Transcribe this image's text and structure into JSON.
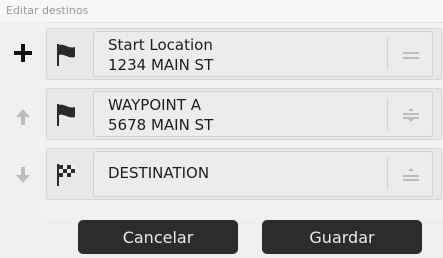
{
  "header": {
    "title": "Editar destinos"
  },
  "routes": [
    {
      "name": "Start Location",
      "address": "1234 MAIN ST",
      "flag_icon": "start-flag-icon",
      "handle_icon": "reorder-handle-icon"
    },
    {
      "name": "WAYPOINT A",
      "address": "5678 MAIN ST",
      "flag_icon": "waypoint-flag-icon",
      "handle_icon": "reorder-handle-icon"
    },
    {
      "name": "DESTINATION",
      "address": "",
      "flag_icon": "destination-checkered-flag-icon",
      "handle_icon": "reorder-handle-icon"
    }
  ],
  "sidebar": {
    "add_icon": "plus-icon",
    "up_icon": "arrow-up-icon",
    "down_icon": "arrow-down-icon",
    "delete_icon": "trash-icon"
  },
  "footer": {
    "cancel_label": "Cancelar",
    "save_label": "Guardar"
  }
}
